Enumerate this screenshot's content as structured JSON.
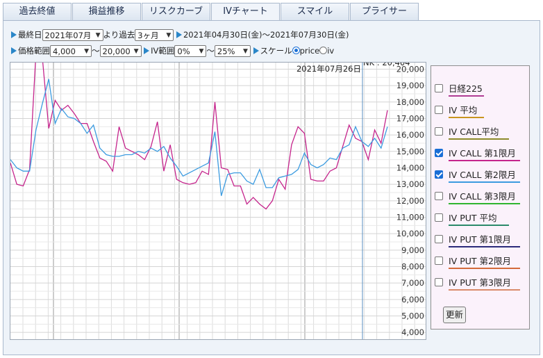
{
  "tabs": [
    {
      "label": "過去終値"
    },
    {
      "label": "損益推移"
    },
    {
      "label": "リスクカーブ"
    },
    {
      "label": "IVチャート",
      "active": true
    },
    {
      "label": "スマイル"
    },
    {
      "label": "プライサー"
    }
  ],
  "controls": {
    "last_day_label": "最終日",
    "last_day_value": "2021年07月",
    "from_label": "より過去",
    "period_value": "3ヶ月",
    "date_range": "2021年04月30日(金)～2021年07月30日(金)",
    "price_range_label": "価格範囲",
    "price_min": "4,000",
    "tilde1": "～",
    "price_max": "20,000",
    "iv_range_label": "IV範囲",
    "iv_min": "0%",
    "tilde2": "～",
    "iv_max": "25%",
    "scale_label": "スケール",
    "scale_price": "price",
    "scale_iv": "iv",
    "scale_selected": "price"
  },
  "chart_data": {
    "type": "line",
    "y_ticks": [
      "20,000",
      "19,000",
      "18,000",
      "17,000",
      "16,000",
      "15,000",
      "14,000",
      "13,000",
      "12,000",
      "11,000",
      "10,000",
      "9,000",
      "8,000",
      "7,000",
      "6,000",
      "5,000",
      "4,000"
    ],
    "ylim": [
      3500,
      20400
    ],
    "crosshair_date": "2021年07月26日",
    "crosshair_value": "NK : 20,404",
    "series": [
      {
        "color": "#c5248c",
        "values": [
          14300,
          13000,
          12900,
          13900,
          21000,
          20700,
          16400,
          18100,
          17500,
          17800,
          17300,
          16700,
          16700,
          15600,
          14600,
          14400,
          13800,
          16500,
          15200,
          15000,
          14800,
          14500,
          15300,
          16800,
          13800,
          15400,
          13300,
          13100,
          13000,
          13100,
          13800,
          13600,
          18000,
          14000,
          13900,
          12900,
          12900,
          11800,
          12200,
          11800,
          11500,
          12000,
          13300,
          12700,
          15400,
          16500,
          16100,
          13300,
          13200,
          13200,
          13800,
          14000,
          15300,
          16600,
          15800,
          15600,
          14500,
          16300,
          15500,
          17500
        ]
      },
      {
        "color": "#3b9be0",
        "values": [
          14500,
          14000,
          13800,
          13800,
          16300,
          17900,
          19400,
          16700,
          17600,
          17100,
          17000,
          16700,
          16100,
          16600,
          15200,
          14800,
          14700,
          14700,
          14800,
          14800,
          15000,
          14900,
          15200,
          15000,
          15300,
          14600,
          14100,
          13500,
          13700,
          13900,
          14100,
          14300,
          16200,
          12300,
          13600,
          13700,
          13700,
          13200,
          13000,
          13900,
          12800,
          12800,
          13400,
          13500,
          13600,
          13900,
          14900,
          14200,
          14000,
          14200,
          14600,
          14500,
          15200,
          15400,
          16500,
          15600,
          15300,
          15800,
          15200,
          16500
        ]
      }
    ]
  },
  "legend": {
    "items": [
      {
        "label": "日経225",
        "checked": false,
        "color": "#b03c94"
      },
      {
        "label": "IV 平均",
        "checked": false,
        "color": "#c8951f"
      },
      {
        "label": "IV CALL平均",
        "checked": false,
        "color": "#8c8a2a"
      },
      {
        "label": "IV CALL 第1限月",
        "checked": true,
        "color": "#c5248c"
      },
      {
        "label": "IV CALL 第2限月",
        "checked": true,
        "color": "#3b9be0"
      },
      {
        "label": "IV CALL 第3限月",
        "checked": false,
        "color": "#2fb52f"
      },
      {
        "label": "IV PUT 平均",
        "checked": false,
        "color": "#2a8a6a"
      },
      {
        "label": "IV PUT 第1限月",
        "checked": false,
        "color": "#2a2a7a"
      },
      {
        "label": "IV PUT 第2限月",
        "checked": false,
        "color": "#d46a3a"
      },
      {
        "label": "IV PUT 第3限月",
        "checked": false,
        "color": "#d98a6a"
      }
    ],
    "update_button": "更新"
  }
}
